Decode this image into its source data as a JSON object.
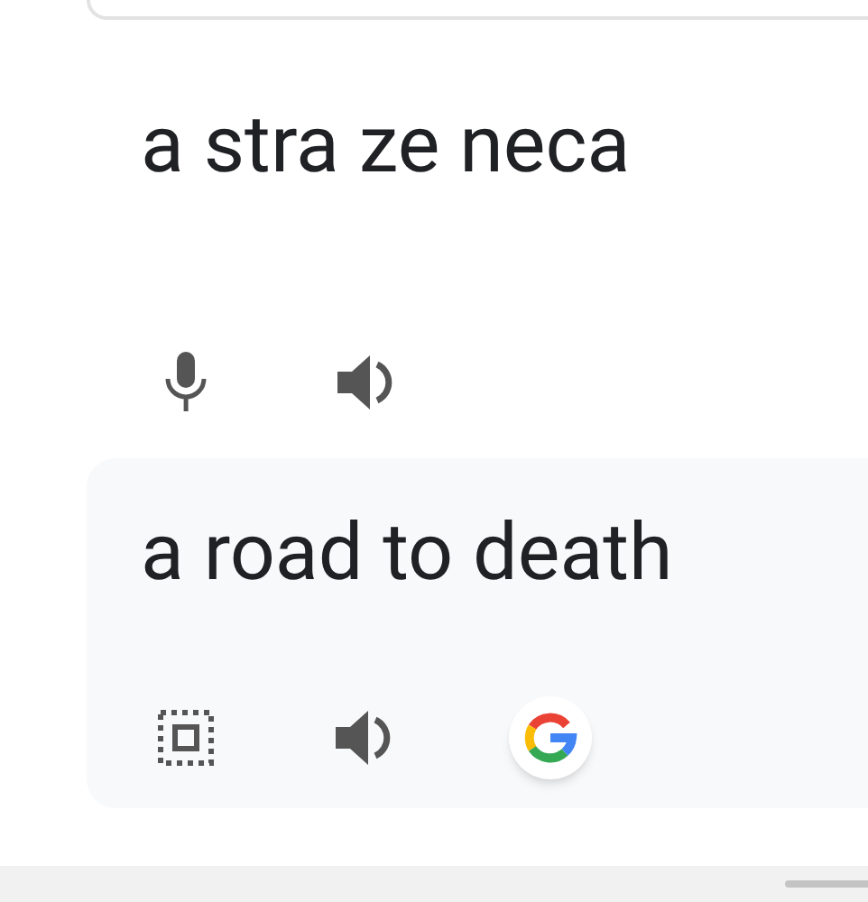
{
  "source": {
    "text": "a stra ze neca"
  },
  "translation": {
    "text": "a road to death"
  }
}
